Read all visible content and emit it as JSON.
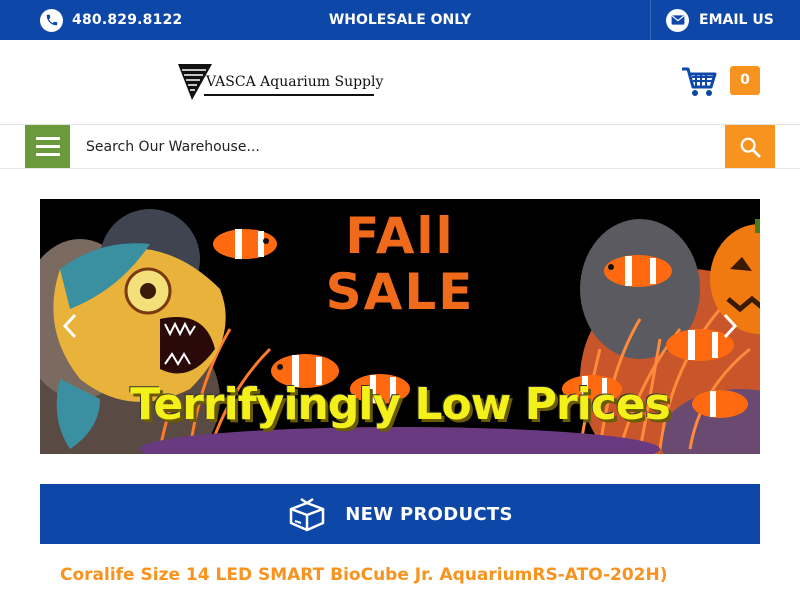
{
  "topbar": {
    "phone": "480.829.8122",
    "center": "WHOLESALE ONLY",
    "email": "EMAIL US"
  },
  "header": {
    "logo_text": "VASCA Aquarium Supply",
    "cart_count": "0"
  },
  "search": {
    "placeholder": "Search Our Warehouse..."
  },
  "banner": {
    "title_line1": "FAll",
    "title_line2": "SALE",
    "subtitle": "Terrifyingly Low Prices"
  },
  "section": {
    "label": "NEW PRODUCTS"
  },
  "product": {
    "title": "Coralife Size 14 LED SMART BioCube Jr. AquariumRS-ATO-202H)"
  },
  "colors": {
    "brand_blue": "#0d47a8",
    "accent_orange": "#f7931e",
    "menu_green": "#6a9a3c"
  },
  "icons": [
    "phone-icon",
    "email-icon",
    "cart-icon",
    "menu-icon",
    "search-icon",
    "chevron-left-icon",
    "chevron-right-icon",
    "box-icon"
  ]
}
